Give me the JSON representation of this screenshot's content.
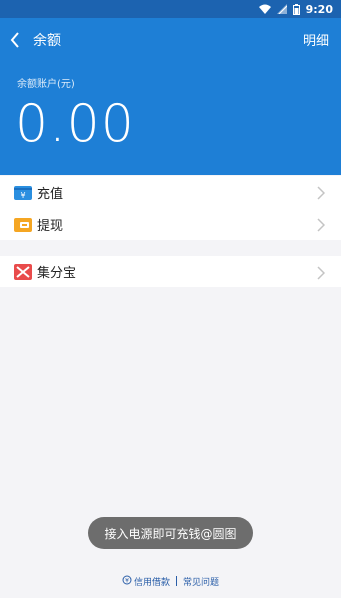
{
  "status_bar": {
    "time": "9:20"
  },
  "header": {
    "title": "余额",
    "details_label": "明细",
    "balance_label": "余额账户(元)",
    "balance_amount": "0.00"
  },
  "menu": {
    "items": [
      {
        "label": "充值",
        "icon": "recharge-icon"
      },
      {
        "label": "提现",
        "icon": "wallet-icon"
      }
    ],
    "items2": [
      {
        "label": "集分宝",
        "icon": "jifenbao-icon"
      }
    ]
  },
  "toast": {
    "text": "接入电源即可充钱@圆图"
  },
  "footer": {
    "credit_label": "信用借款",
    "faq_label": "常见问题"
  },
  "colors": {
    "header_bg": "#1e7fd6",
    "status_bg": "#1c63b0",
    "recharge_icon": "#2a8fe0",
    "wallet_icon": "#f5a623",
    "jifenbao_icon": "#e94b4b"
  }
}
